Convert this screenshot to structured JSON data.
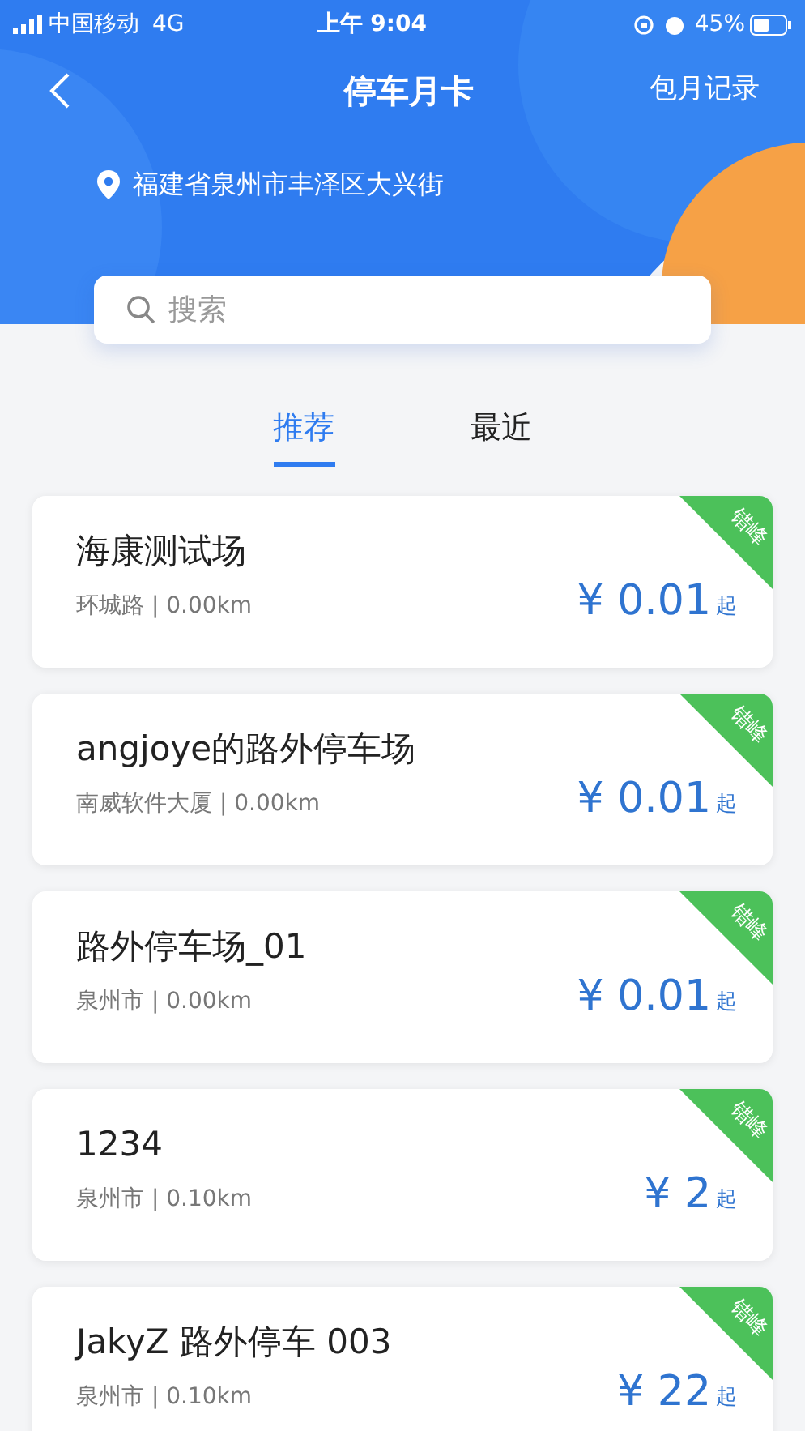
{
  "status_bar": {
    "carrier": "中国移动",
    "network": "4G",
    "time": "上午 9:04",
    "battery": "45%"
  },
  "nav": {
    "title": "停车月卡",
    "action": "包月记录"
  },
  "location": "福建省泉州市丰泽区大兴街",
  "search": {
    "placeholder": "搜索"
  },
  "tabs": [
    {
      "label": "推荐",
      "selected": true
    },
    {
      "label": "最近",
      "selected": false
    }
  ],
  "lots": [
    {
      "name": "海康测试场",
      "detail": "环城路 | 0.00km",
      "price": "¥ 0.01",
      "suffix": "起",
      "badge": "错峰"
    },
    {
      "name": "angjoye的路外停车场",
      "detail": "南威软件大厦 | 0.00km",
      "price": "¥ 0.01",
      "suffix": "起",
      "badge": "错峰"
    },
    {
      "name": "路外停车场_01",
      "detail": "泉州市 | 0.00km",
      "price": "¥ 0.01",
      "suffix": "起",
      "badge": "错峰"
    },
    {
      "name": "1234",
      "detail": "泉州市 | 0.10km",
      "price": "¥ 2",
      "suffix": "起",
      "badge": "错峰"
    },
    {
      "name": "JakyZ 路外停车 003",
      "detail": "泉州市 | 0.10km",
      "price": "¥ 22",
      "suffix": "起",
      "badge": "错峰"
    }
  ]
}
